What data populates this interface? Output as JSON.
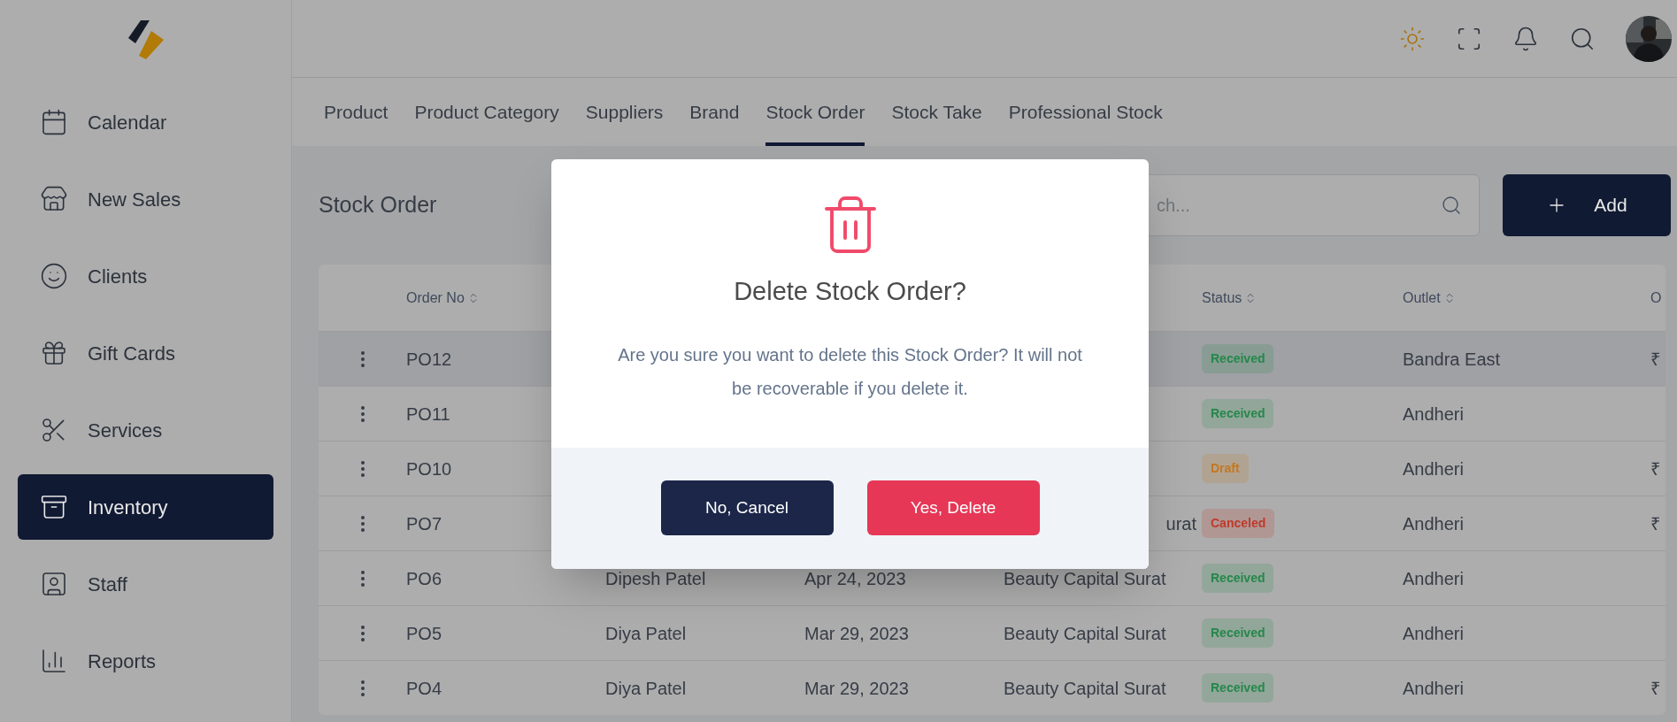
{
  "sidebar": {
    "items": [
      {
        "label": "Calendar",
        "kind": "calendar",
        "selected": false
      },
      {
        "label": "New Sales",
        "kind": "store",
        "selected": false
      },
      {
        "label": "Clients",
        "kind": "face",
        "selected": false
      },
      {
        "label": "Gift Cards",
        "kind": "gift",
        "selected": false
      },
      {
        "label": "Services",
        "kind": "scissors",
        "selected": false
      },
      {
        "label": "Inventory",
        "kind": "archive",
        "selected": true
      },
      {
        "label": "Staff",
        "kind": "badge",
        "selected": false
      },
      {
        "label": "Reports",
        "kind": "chart",
        "selected": false
      }
    ]
  },
  "tabs": [
    {
      "label": "Product",
      "selected": false
    },
    {
      "label": "Product Category",
      "selected": false
    },
    {
      "label": "Suppliers",
      "selected": false
    },
    {
      "label": "Brand",
      "selected": false
    },
    {
      "label": "Stock Order",
      "selected": true
    },
    {
      "label": "Stock Take",
      "selected": false
    },
    {
      "label": "Professional Stock",
      "selected": false
    }
  ],
  "page_title": "Stock Order",
  "search": {
    "placeholder": "ch..."
  },
  "add_button": {
    "label": "Add"
  },
  "table": {
    "columns": [
      {
        "label": "Order No",
        "sortable": true
      },
      {
        "label": "Status",
        "sortable": true
      },
      {
        "label": "Outlet",
        "sortable": true
      },
      {
        "label": "O",
        "sortable": false
      }
    ],
    "rows": [
      {
        "selected": true,
        "order_no": "PO12",
        "status": {
          "label": "Received",
          "color": "#24884a"
        },
        "outlet": "Bandra East",
        "column_8": "₹"
      },
      {
        "selected": false,
        "order_no": "PO11",
        "status": {
          "label": "Received",
          "color": "#24884a"
        },
        "outlet": "Andheri"
      },
      {
        "selected": false,
        "order_no": "PO10",
        "status": {
          "label": "Draft",
          "color": "#c4781e"
        },
        "outlet": "Andheri",
        "column_8": "₹"
      },
      {
        "selected": false,
        "order_no": "PO7",
        "column_5": "urat",
        "column_5_clipped": true,
        "status": {
          "label": "Canceled",
          "color": "#c0392b"
        },
        "outlet": "Andheri",
        "column_8": "₹"
      },
      {
        "selected": false,
        "order_no": "PO6",
        "column_3": "Dipesh Patel",
        "column_4": "Apr 24, 2023",
        "column_5": "Beauty Capital Surat",
        "column_5_clipped": false,
        "status": {
          "label": "Received",
          "color": "#24884a"
        },
        "outlet": "Andheri"
      },
      {
        "selected": false,
        "order_no": "PO5",
        "column_3": "Diya Patel",
        "column_4": "Mar 29, 2023",
        "column_5": "Beauty Capital Surat",
        "column_5_clipped": false,
        "status": {
          "label": "Received",
          "color": "#24884a"
        },
        "outlet": "Andheri"
      },
      {
        "selected": false,
        "order_no": "PO4",
        "column_3": "Diya Patel",
        "column_4": "Mar 29, 2023",
        "column_5": "Beauty Capital Surat",
        "column_5_clipped": false,
        "status": {
          "label": "Received",
          "color": "#24884a"
        },
        "outlet": "Andheri",
        "column_8": "₹"
      }
    ]
  },
  "dialog": {
    "title": "Delete Stock Order?",
    "message": "Are you sure you want to delete this Stock Order? It will not be recoverable if you delete it.",
    "buttons": [
      {
        "label": "No, Cancel",
        "kind": "cancel"
      },
      {
        "label": "Yes, Delete",
        "kind": "danger"
      }
    ]
  }
}
